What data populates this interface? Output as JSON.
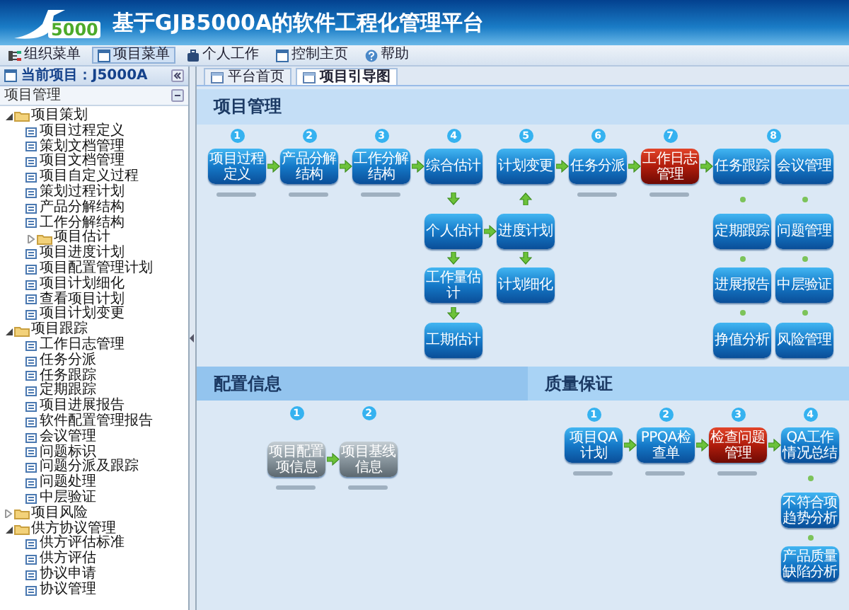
{
  "header": {
    "logo_text": "5000",
    "title": "基于GJB5000A的软件工程化管理平台"
  },
  "toolbar": [
    {
      "label": "组织菜单",
      "selected": false
    },
    {
      "label": "项目菜单",
      "selected": true
    },
    {
      "label": "个人工作",
      "selected": false
    },
    {
      "label": "控制主页",
      "selected": false
    },
    {
      "label": "帮助",
      "selected": false
    }
  ],
  "project_panel": {
    "title": "当前项目：J5000A",
    "section": "项目管理",
    "tree": [
      {
        "label": "项目策划",
        "kind": "folder",
        "expanded": true,
        "children": [
          {
            "label": "项目过程定义",
            "kind": "leaf"
          },
          {
            "label": "策划文档管理",
            "kind": "leaf"
          },
          {
            "label": "项目文档管理",
            "kind": "leaf"
          },
          {
            "label": "项目自定义过程",
            "kind": "leaf"
          },
          {
            "label": "策划过程计划",
            "kind": "leaf"
          },
          {
            "label": "产品分解结构",
            "kind": "leaf"
          },
          {
            "label": "工作分解结构",
            "kind": "leaf"
          },
          {
            "label": "项目估计",
            "kind": "folder",
            "expanded": false
          },
          {
            "label": "项目进度计划",
            "kind": "leaf"
          },
          {
            "label": "项目配置管理计划",
            "kind": "leaf"
          },
          {
            "label": "项目计划细化",
            "kind": "leaf"
          },
          {
            "label": "查看项目计划",
            "kind": "leaf"
          },
          {
            "label": "项目计划变更",
            "kind": "leaf"
          }
        ]
      },
      {
        "label": "项目跟踪",
        "kind": "folder",
        "expanded": true,
        "children": [
          {
            "label": "工作日志管理",
            "kind": "leaf"
          },
          {
            "label": "任务分派",
            "kind": "leaf"
          },
          {
            "label": "任务跟踪",
            "kind": "leaf"
          },
          {
            "label": "定期跟踪",
            "kind": "leaf"
          },
          {
            "label": "项目进展报告",
            "kind": "leaf"
          },
          {
            "label": "软件配置管理报告",
            "kind": "leaf"
          },
          {
            "label": "会议管理",
            "kind": "leaf"
          },
          {
            "label": "问题标识",
            "kind": "leaf"
          },
          {
            "label": "问题分派及跟踪",
            "kind": "leaf"
          },
          {
            "label": "问题处理",
            "kind": "leaf"
          },
          {
            "label": "中层验证",
            "kind": "leaf"
          }
        ]
      },
      {
        "label": "项目风险",
        "kind": "folder",
        "expanded": false
      },
      {
        "label": "供方协议管理",
        "kind": "folder",
        "expanded": true,
        "children": [
          {
            "label": "供方评估标准",
            "kind": "leaf"
          },
          {
            "label": "供方评估",
            "kind": "leaf"
          },
          {
            "label": "协议申请",
            "kind": "leaf"
          },
          {
            "label": "协议管理",
            "kind": "leaf"
          }
        ]
      }
    ]
  },
  "tabs": [
    {
      "label": "平台首页",
      "selected": false
    },
    {
      "label": "项目引导图",
      "selected": true
    }
  ],
  "sections": [
    {
      "title": "项目管理",
      "step_numbers": [
        "1",
        "2",
        "3",
        "4",
        "5",
        "6",
        "7",
        "8"
      ],
      "nodes": [
        {
          "label": "项目过程定义",
          "kind": "normal"
        },
        {
          "label": "产品分解结构",
          "kind": "normal"
        },
        {
          "label": "工作分解结构",
          "kind": "normal"
        },
        {
          "label": "综合估计",
          "kind": "normal"
        },
        {
          "label": "计划变更",
          "kind": "normal"
        },
        {
          "label": "任务分派",
          "kind": "normal"
        },
        {
          "label": "工作日志管理",
          "kind": "current"
        },
        {
          "label": "任务跟踪",
          "kind": "normal"
        },
        {
          "label": "会议管理",
          "kind": "normal"
        },
        {
          "label": "个人估计",
          "kind": "normal"
        },
        {
          "label": "进度计划",
          "kind": "normal"
        },
        {
          "label": "定期跟踪",
          "kind": "normal"
        },
        {
          "label": "问题管理",
          "kind": "normal"
        },
        {
          "label": "工作量估计",
          "kind": "normal"
        },
        {
          "label": "计划细化",
          "kind": "normal"
        },
        {
          "label": "进展报告",
          "kind": "normal"
        },
        {
          "label": "中层验证",
          "kind": "normal"
        },
        {
          "label": "工期估计",
          "kind": "normal"
        },
        {
          "label": "挣值分析",
          "kind": "normal"
        },
        {
          "label": "风险管理",
          "kind": "normal"
        }
      ]
    },
    {
      "title": "配置信息",
      "step_numbers": [
        "1",
        "2"
      ],
      "nodes": [
        {
          "label": "项目配置项信息",
          "kind": "inactive"
        },
        {
          "label": "项目基线信息",
          "kind": "inactive"
        }
      ]
    },
    {
      "title": "质量保证",
      "step_numbers": [
        "1",
        "2",
        "3",
        "4"
      ],
      "nodes": [
        {
          "label": "项目QA计划",
          "kind": "normal"
        },
        {
          "label": "PPQA检查单",
          "kind": "normal"
        },
        {
          "label": "检查问题管理",
          "kind": "current"
        },
        {
          "label": "QA工作情况总结",
          "kind": "normal"
        },
        {
          "label": "不符合项趋势分析",
          "kind": "normal"
        },
        {
          "label": "产品质量缺陷分析",
          "kind": "normal"
        }
      ]
    }
  ]
}
